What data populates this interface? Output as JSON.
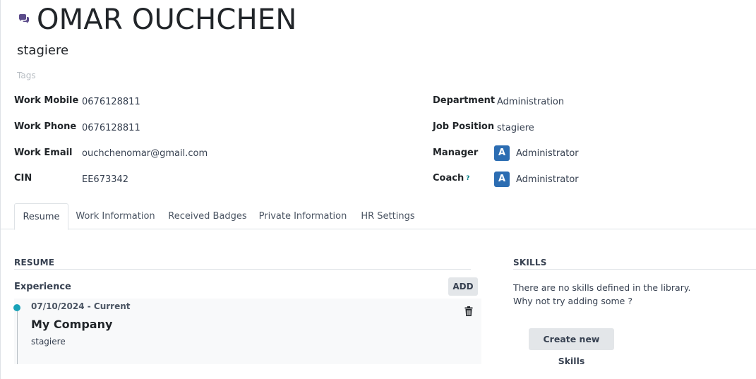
{
  "employee": {
    "name": "OMAR OUCHCHEN",
    "job_title": "stagiere",
    "tags_placeholder": "Tags",
    "chat_icon": "chat-bubbles-icon"
  },
  "left_fields": [
    {
      "label": "Work Mobile",
      "value": "0676128811"
    },
    {
      "label": "Work Phone",
      "value": "0676128811"
    },
    {
      "label": "Work Email",
      "value": "ouchchenomar@gmail.com"
    },
    {
      "label": "CIN",
      "value": "EE673342"
    }
  ],
  "right_fields": [
    {
      "label": "Department",
      "value": "Administration"
    },
    {
      "label": "Job Position",
      "value": "stagiere"
    },
    {
      "label": "Manager",
      "value": "Administrator",
      "avatar": "A"
    },
    {
      "label": "Coach",
      "value": "Administrator",
      "avatar": "A",
      "help": "?"
    }
  ],
  "tabs": [
    {
      "label": "Resume",
      "active": true
    },
    {
      "label": "Work Information",
      "active": false
    },
    {
      "label": "Received Badges",
      "active": false
    },
    {
      "label": "Private Information",
      "active": false
    },
    {
      "label": "HR Settings",
      "active": false
    }
  ],
  "resume": {
    "title": "RESUME",
    "experience_label": "Experience",
    "add_label": "ADD",
    "entries": [
      {
        "dates": "07/10/2024 - Current",
        "company": "My Company",
        "description": "stagiere"
      }
    ]
  },
  "skills": {
    "title": "SKILLS",
    "empty_line1": "There are no skills defined in the library.",
    "empty_line2": "Why not try adding some ?",
    "create_label": "Create new Skills"
  },
  "colors": {
    "avatar_bg": "#2c6db2",
    "timeline_dot": "#18a2b8",
    "chat_icon": "#5b4b8a"
  }
}
